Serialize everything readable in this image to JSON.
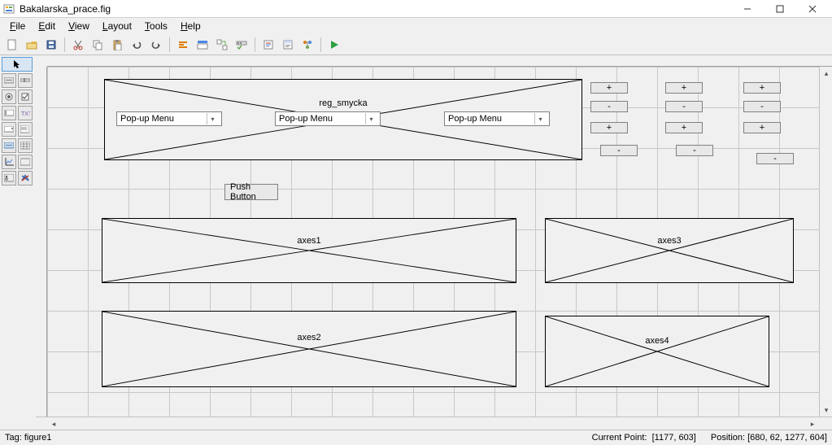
{
  "window": {
    "title": "Bakalarska_prace.fig"
  },
  "menubar": {
    "file": "File",
    "edit": "Edit",
    "view": "View",
    "layout": "Layout",
    "tools": "Tools",
    "help": "Help"
  },
  "canvas": {
    "main_axes_label": "reg_smycka",
    "popup1": "Pop-up Menu",
    "popup2": "Pop-up Menu",
    "popup3": "Pop-up Menu",
    "pushbutton": "Push Button",
    "axes1": "axes1",
    "axes2": "axes2",
    "axes3": "axes3",
    "axes4": "axes4",
    "plus": "+",
    "minus": "-"
  },
  "status": {
    "tag": "Tag: figure1",
    "current_point_label": "Current Point:",
    "current_point_value": "[1177, 603]",
    "position_label": "Position:",
    "position_value": "[680, 62, 1277, 604]"
  }
}
